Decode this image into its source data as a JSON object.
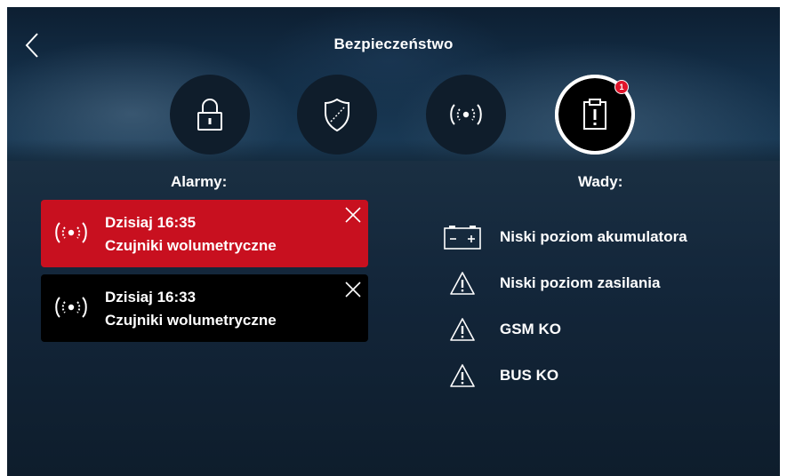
{
  "header": {
    "title": "Bezpieczeństwo"
  },
  "tabs": [
    {
      "icon": "lock-icon"
    },
    {
      "icon": "shield-icon"
    },
    {
      "icon": "sensor-icon"
    },
    {
      "icon": "clipboard-alert-icon",
      "active": true,
      "badge": "1"
    }
  ],
  "alarms": {
    "label": "Alarmy:",
    "items": [
      {
        "time": "Dzisiaj 16:35",
        "description": "Czujniki wolumetryczne",
        "color": "#c8101f"
      },
      {
        "time": "Dzisiaj 16:33",
        "description": "Czujniki wolumetryczne",
        "color": "#000000"
      }
    ]
  },
  "faults": {
    "label": "Wady:",
    "items": [
      {
        "icon": "battery-icon",
        "text": "Niski poziom akumulatora"
      },
      {
        "icon": "warning-icon",
        "text": "Niski poziom zasilania"
      },
      {
        "icon": "warning-icon",
        "text": "GSM KO"
      },
      {
        "icon": "warning-icon",
        "text": "BUS KO"
      }
    ]
  }
}
